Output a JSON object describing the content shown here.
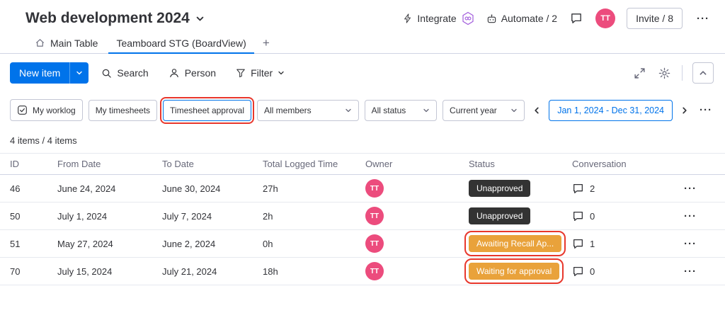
{
  "header": {
    "title": "Web development 2024",
    "integrate": "Integrate",
    "automate": "Automate / 2",
    "invite": "Invite / 8",
    "avatar": "TT"
  },
  "tabs": {
    "main_table": "Main Table",
    "board": "Teamboard STG (BoardView)",
    "add": "+"
  },
  "toolbar": {
    "new_item": "New item",
    "search": "Search",
    "person": "Person",
    "filter": "Filter"
  },
  "filters": {
    "my_worklog": "My worklog",
    "my_timesheets": "My timesheets",
    "timesheet_approval": "Timesheet approval",
    "members": "All members",
    "status": "All status",
    "year": "Current year",
    "date_range": "Jan 1, 2024 - Dec 31, 2024"
  },
  "summary": "4 items / 4 items",
  "glyphs": {
    "more": "···"
  },
  "table": {
    "columns": {
      "id": "ID",
      "from": "From Date",
      "to": "To Date",
      "logged": "Total Logged Time",
      "owner": "Owner",
      "status": "Status",
      "conversation": "Conversation"
    },
    "rows": [
      {
        "id": "46",
        "from": "June 24, 2024",
        "to": "June 30, 2024",
        "logged": "27h",
        "owner": "TT",
        "status": "Unapproved",
        "status_type": "dark",
        "conversation": "2",
        "annotated": false
      },
      {
        "id": "50",
        "from": "July 1, 2024",
        "to": "July 7, 2024",
        "logged": "2h",
        "owner": "TT",
        "status": "Unapproved",
        "status_type": "dark",
        "conversation": "0",
        "annotated": false
      },
      {
        "id": "51",
        "from": "May 27, 2024",
        "to": "June 2, 2024",
        "logged": "0h",
        "owner": "TT",
        "status": "Awaiting Recall Ap...",
        "status_type": "amber",
        "conversation": "1",
        "annotated": true
      },
      {
        "id": "70",
        "from": "July 15, 2024",
        "to": "July 21, 2024",
        "logged": "18h",
        "owner": "TT",
        "status": "Waiting for approval",
        "status_type": "amber",
        "conversation": "0",
        "annotated": true
      }
    ]
  },
  "icons": {
    "title-chevron": "chevron-down",
    "integrate": "lightning",
    "integrations-badge": "purple-hexagon",
    "automate": "robot",
    "chat": "speech-bubble",
    "main-table": "home",
    "new-item-caret": "chevron-down",
    "search": "magnifier",
    "person": "person-silhouette",
    "filter": "funnel",
    "expand": "diagonal-arrows",
    "settings": "gear",
    "collapse": "chevron-up",
    "my-worklog": "checkbox-check",
    "select-caret": "chevron-down",
    "prev": "chevron-left",
    "next": "chevron-right",
    "conversation": "speech-bubble"
  },
  "colors": {
    "accent_blue": "#0073ea",
    "badge_dark": "#333333",
    "badge_amber": "#e9a23b",
    "avatar_pink": "#ec4c7d",
    "annotation_red": "#e8372c",
    "tab_underline": "#0073ea"
  }
}
